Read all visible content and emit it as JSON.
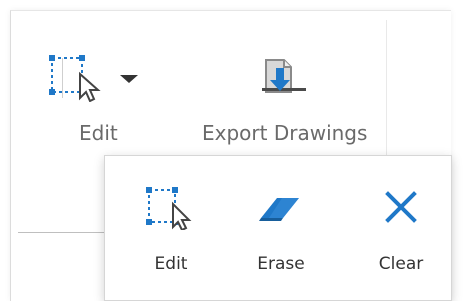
{
  "ribbon": {
    "edit_label": "Edit",
    "export_label": "Export Drawings"
  },
  "popup": {
    "items": [
      {
        "label": "Edit",
        "icon": "selection-cursor-icon"
      },
      {
        "label": "Erase",
        "icon": "eraser-icon"
      },
      {
        "label": "Clear",
        "icon": "close-icon"
      }
    ]
  },
  "colors": {
    "accent_blue": "#1f78c8",
    "label_gray": "#6a6a6a",
    "text_dark": "#333333"
  }
}
